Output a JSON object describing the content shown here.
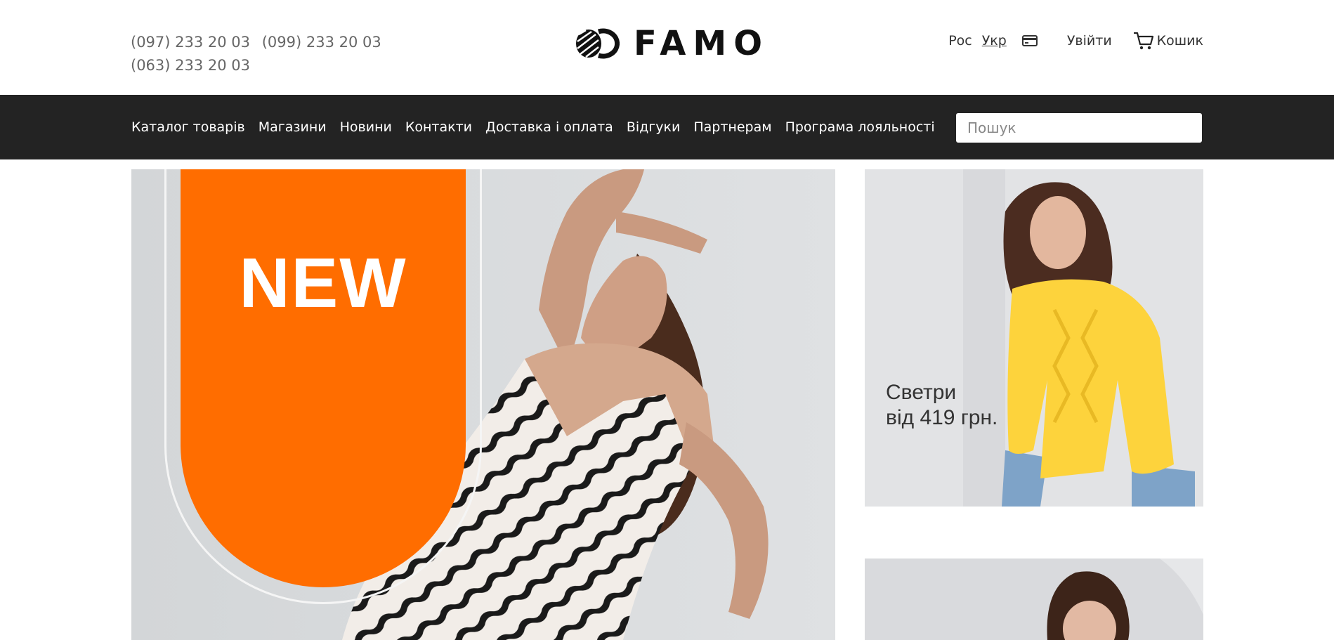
{
  "header": {
    "phones": [
      "(097) 233 20 03",
      "(099) 233 20 03",
      "(063) 233 20 03"
    ],
    "logo_text": "FAMO",
    "lang_ru": "Рос",
    "lang_ua": "Укр",
    "card_icon": "credit-card-icon",
    "login_label": "Увійти",
    "cart_icon": "cart-icon",
    "cart_label": "Кошик"
  },
  "nav": {
    "links": [
      "Каталог товарів",
      "Магазини",
      "Новини",
      "Контакти",
      "Доставка і оплата",
      "Відгуки",
      "Партнерам",
      "Програма лояльності"
    ],
    "search_placeholder": "Пошук"
  },
  "banners": {
    "main_badge": "NEW",
    "side_caption_line1": "Светри",
    "side_caption_line2": "від 419 грн."
  },
  "colors": {
    "nav_bg": "#232323",
    "badge_orange": "#ff6d00",
    "sweater_yellow": "#fdd33c"
  }
}
